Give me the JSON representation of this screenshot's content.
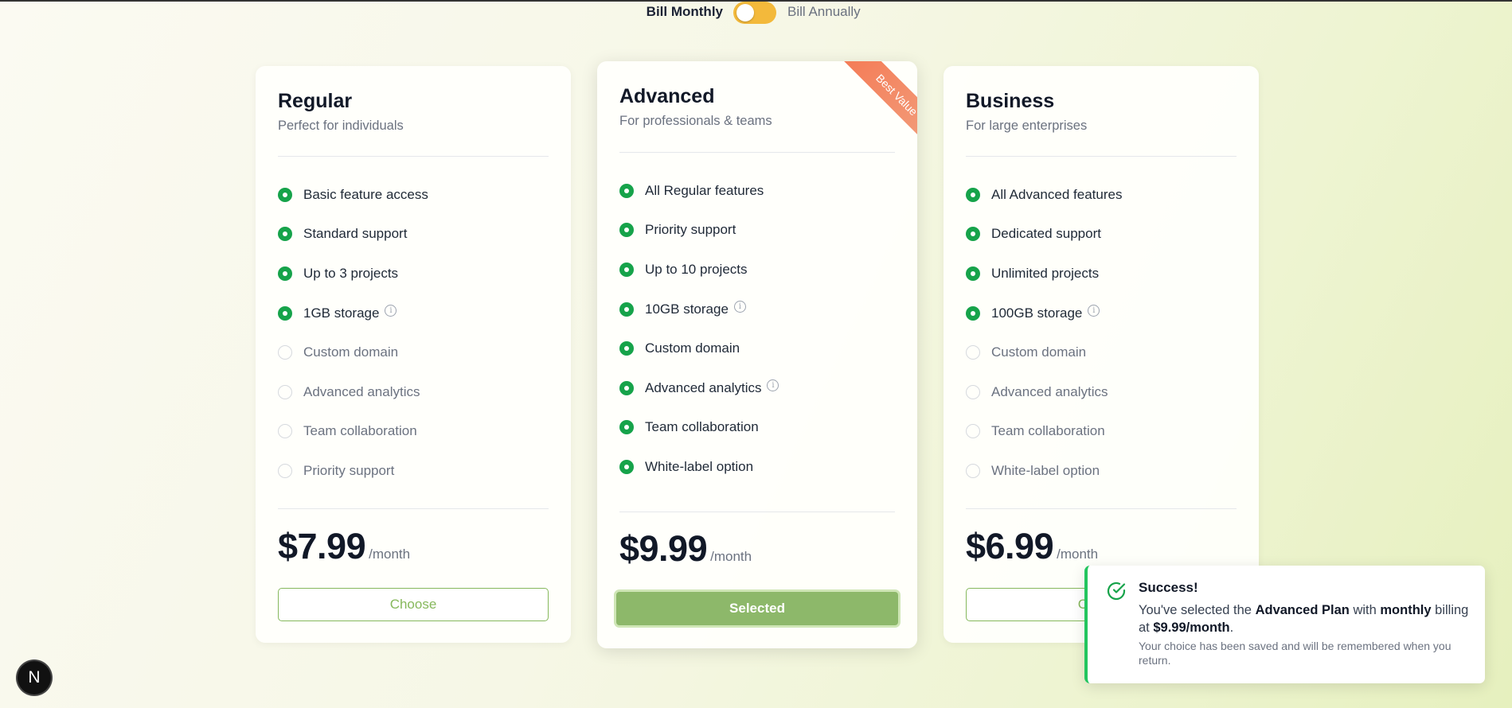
{
  "billing": {
    "monthly_label": "Bill Monthly",
    "annually_label": "Bill Annually",
    "selected": "monthly"
  },
  "plans": [
    {
      "name": "Regular",
      "description": "Perfect for individuals",
      "features": [
        {
          "label": "Basic feature access",
          "included": true,
          "info": false
        },
        {
          "label": "Standard support",
          "included": true,
          "info": false
        },
        {
          "label": "Up to 3 projects",
          "included": true,
          "info": false
        },
        {
          "label": "1GB storage",
          "included": true,
          "info": true
        },
        {
          "label": "Custom domain",
          "included": false,
          "info": false
        },
        {
          "label": "Advanced analytics",
          "included": false,
          "info": false
        },
        {
          "label": "Team collaboration",
          "included": false,
          "info": false
        },
        {
          "label": "Priority support",
          "included": false,
          "info": false
        }
      ],
      "price": "$7.99",
      "period": "/month",
      "button_label": "Choose"
    },
    {
      "name": "Advanced",
      "description": "For professionals & teams",
      "badge": "Best Value",
      "features": [
        {
          "label": "All Regular features",
          "included": true,
          "info": false
        },
        {
          "label": "Priority support",
          "included": true,
          "info": false
        },
        {
          "label": "Up to 10 projects",
          "included": true,
          "info": false
        },
        {
          "label": "10GB storage",
          "included": true,
          "info": true
        },
        {
          "label": "Custom domain",
          "included": true,
          "info": false
        },
        {
          "label": "Advanced analytics",
          "included": true,
          "info": true
        },
        {
          "label": "Team collaboration",
          "included": true,
          "info": false
        },
        {
          "label": "White-label option",
          "included": true,
          "info": false
        }
      ],
      "price": "$9.99",
      "period": "/month",
      "button_label": "Selected"
    },
    {
      "name": "Business",
      "description": "For large enterprises",
      "features": [
        {
          "label": "All Advanced features",
          "included": true,
          "info": false
        },
        {
          "label": "Dedicated support",
          "included": true,
          "info": false
        },
        {
          "label": "Unlimited projects",
          "included": true,
          "info": false
        },
        {
          "label": "100GB storage",
          "included": true,
          "info": true
        },
        {
          "label": "Custom domain",
          "included": false,
          "info": false
        },
        {
          "label": "Advanced analytics",
          "included": false,
          "info": false
        },
        {
          "label": "Team collaboration",
          "included": false,
          "info": false
        },
        {
          "label": "White-label option",
          "included": false,
          "info": false
        }
      ],
      "price": "$6.99",
      "period": "/month",
      "button_label": "Choose"
    }
  ],
  "toast": {
    "title": "Success!",
    "msg_prefix": "You've selected the ",
    "plan": "Advanced Plan",
    "msg_with": " with ",
    "cycle": "monthly",
    "msg_billing": " billing at ",
    "amount": "$9.99/month",
    "msg_end": ".",
    "note": "Your choice has been saved and will be remembered when you return."
  },
  "dev_badge": "N",
  "info_glyph": "i",
  "colors": {
    "accent_green": "#16a34a",
    "button_green": "#8db86a",
    "toggle": "#f3b93b",
    "ribbon": "#f47a55"
  }
}
